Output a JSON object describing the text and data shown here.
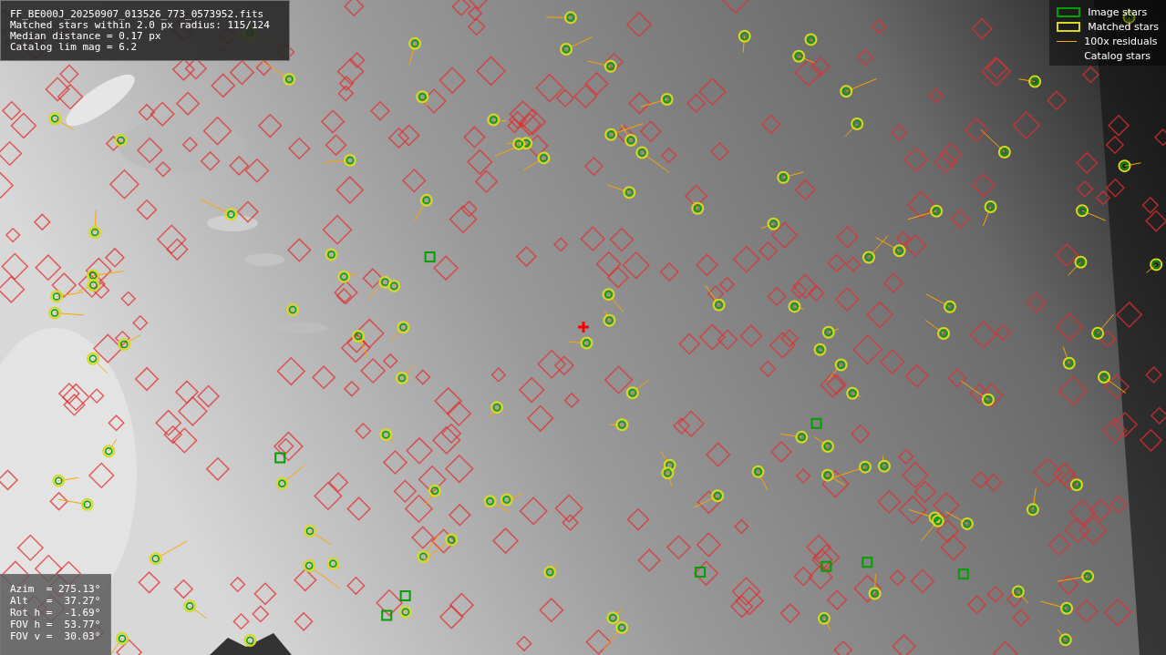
{
  "info_panel": {
    "lines": [
      "FF_BE000J_20250907_013526_773_0573952.fits",
      "Matched stars within 2.0 px radius: 115/124",
      "Median distance = 0.17 px",
      "Catalog lim mag = 6.2"
    ]
  },
  "pointing_panel": {
    "lines": [
      "Azim  = 275.13°",
      "Alt   =  37.27°",
      "Rot h =  -1.69°",
      "FOV h =  53.77°",
      "FOV v =  30.03°"
    ]
  },
  "legend": [
    {
      "kind": "box",
      "label": "Image stars",
      "color": "#00a000"
    },
    {
      "kind": "box",
      "label": "Matched stars",
      "color": "#d8d820"
    },
    {
      "kind": "line",
      "label": "100x residuals",
      "color": "#ffa500"
    },
    {
      "kind": "none",
      "label": "Catalog stars"
    }
  ]
}
